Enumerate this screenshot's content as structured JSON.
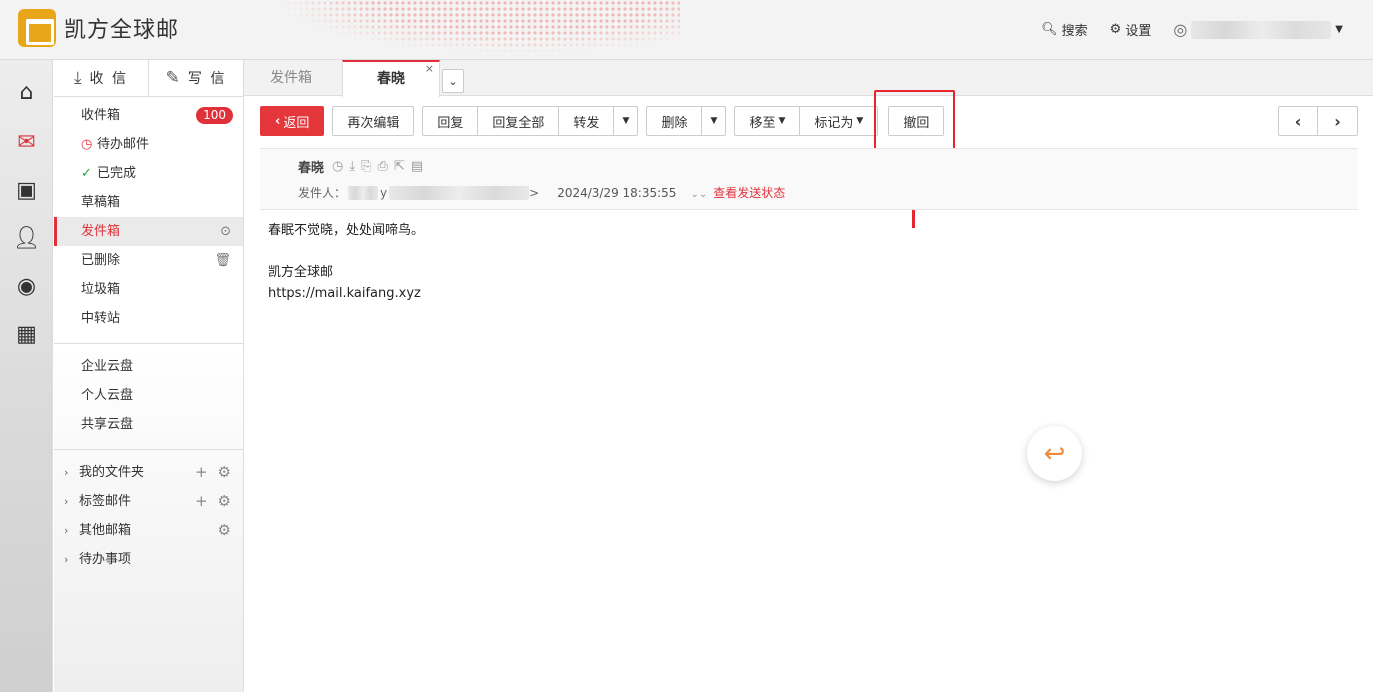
{
  "app": {
    "logo_text": "凯方全球邮",
    "search_label": "搜索",
    "settings_label": "设置"
  },
  "rail": {
    "items": [
      "home-icon",
      "mail-icon",
      "contacts-icon",
      "add-user-icon",
      "disc-icon",
      "calendar-icon"
    ]
  },
  "sidebar": {
    "inbox_tab": "收 信",
    "compose_tab": "写 信",
    "folders": [
      {
        "label": "收件箱",
        "badge": "100"
      },
      {
        "label": "待办邮件"
      },
      {
        "label": "已完成"
      },
      {
        "label": "草稿箱"
      },
      {
        "label": "发件箱",
        "active": true
      },
      {
        "label": "已删除"
      },
      {
        "label": "垃圾箱"
      },
      {
        "label": "中转站"
      }
    ],
    "disks": [
      "企业云盘",
      "个人云盘",
      "共享云盘"
    ],
    "trees": [
      "我的文件夹",
      "标签邮件",
      "其他邮箱",
      "待办事项"
    ]
  },
  "tabs": {
    "outbox": "发件箱",
    "current": "春晓",
    "close": "×"
  },
  "toolbar": {
    "back": "返回",
    "reedit": "再次编辑",
    "reply": "回复",
    "reply_all": "回复全部",
    "forward": "转发",
    "delete": "删除",
    "move_to": "移至",
    "mark_as": "标记为",
    "recall": "撤回"
  },
  "mail": {
    "subject": "春晓",
    "from_label": "发件人：",
    "from_visible": "y",
    "from_suffix": ">",
    "date": "2024/3/29 18:35:55",
    "status_link": "查看发送状态",
    "body": [
      "春眠不觉晓，处处闻啼鸟。",
      "",
      "凯方全球邮",
      "https://mail.kaifang.xyz"
    ]
  },
  "colors": {
    "accent": "#e0303a",
    "highlight": "#e5262c",
    "fab": "#f08a3c"
  }
}
